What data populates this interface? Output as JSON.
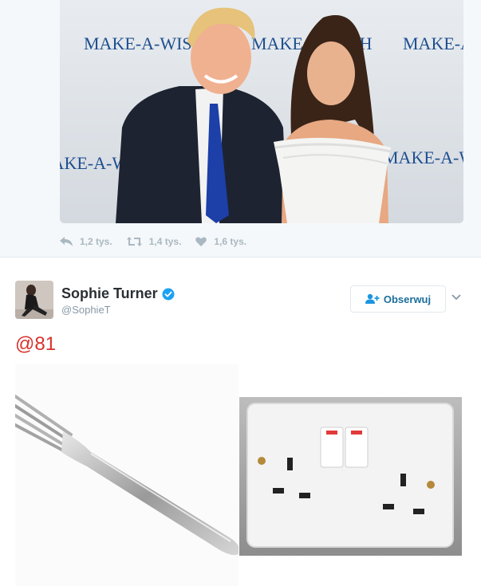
{
  "previous_tweet": {
    "photo": {
      "backdrop_text": [
        "MAKE-A-WISH",
        "MAKE-A-WISH",
        "MAKE-A-WISH",
        "MAKE-A-WISH",
        "MAKE-A-WISH"
      ]
    },
    "actions": {
      "replies": "1,2 tys.",
      "retweets": "1,4 tys.",
      "likes": "1,6 tys."
    }
  },
  "tweet": {
    "author_name": "Sophie Turner",
    "author_handle": "@SophieT",
    "verified": true,
    "follow_label": "Obserwuj",
    "text": "@81",
    "images": [
      "fork-icon",
      "power-socket-icon"
    ]
  },
  "colors": {
    "accent": "#1b95e0",
    "verified": "#1da1f2",
    "action_gray": "#aab8c2",
    "text_red": "#d8322d"
  }
}
